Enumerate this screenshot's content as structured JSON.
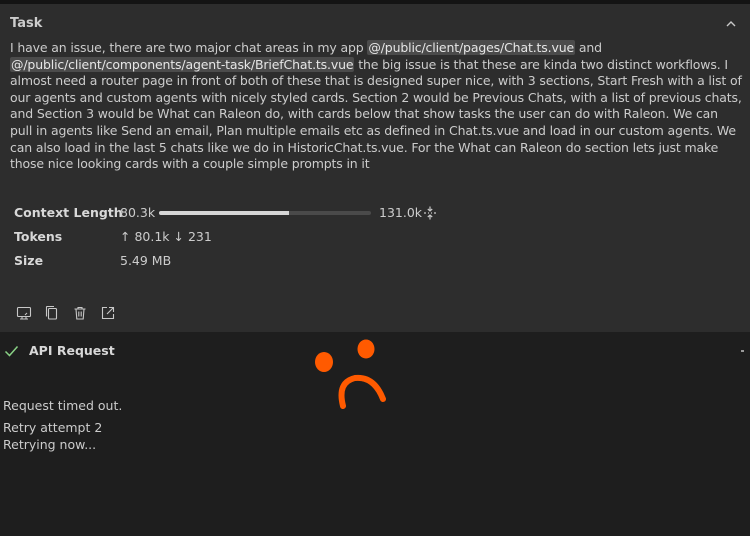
{
  "task": {
    "header": "Task",
    "text_parts": {
      "p1": "I have an issue, there are two major chat areas in my app ",
      "mention1": "@/public/client/pages/Chat.ts.vue",
      "p2": " and ",
      "mention2": "@/public/client/components/agent-task/BriefChat.ts.vue",
      "p3": " the big issue is that these are kinda two distinct workflows. I almost need a router page in front of both of these that is designed super nice, with 3 sections, Start Fresh with a list of our agents and custom agents with nicely styled cards. Section 2 would be Previous Chats, with a list of previous chats, and Section 3 would be What can Raleon do, with cards below that show tasks the user can do with Raleon. We can pull in agents like Send an email, Plan multiple emails etc as defined in Chat.ts.vue and load in our custom agents. We can also load in the last 5 chats like we do in HistoricChat.ts.vue. For the What can Raleon do section lets just make those nice looking cards with a couple simple prompts in it"
    }
  },
  "stats": {
    "context_length_label": "Context Length",
    "context_used": "80.3k",
    "context_max": "131.0k",
    "context_fraction": 0.613,
    "tokens_label": "Tokens",
    "tokens_value": "↑ 80.1k ↓ 231",
    "size_label": "Size",
    "size_value": "5.49 MB"
  },
  "toolbar": {
    "icons": [
      "terminal-icon",
      "copy-icon",
      "trash-icon",
      "open-external-icon"
    ]
  },
  "api_request": {
    "title": "API Request",
    "status_icon": "checkmark-icon",
    "status_color": "#89d185"
  },
  "messages": {
    "timeout": "Request timed out.",
    "retry": "Retry attempt 2",
    "retrying": "Retrying now..."
  },
  "colors": {
    "panel_bg": "#2d2d2d",
    "page_bg": "#1e1e1e",
    "annotation": "#ff5a00"
  }
}
